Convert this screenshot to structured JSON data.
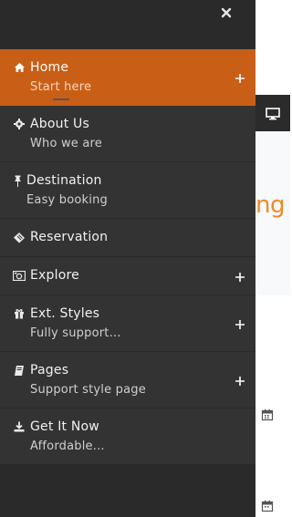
{
  "menu": {
    "items": [
      {
        "label": "Home",
        "sub": "Start here",
        "icon": "home-icon",
        "expandable": true,
        "active": true
      },
      {
        "label": "About Us",
        "sub": "Who we are",
        "icon": "gear-icon",
        "expandable": false,
        "active": false
      },
      {
        "label": "Destination",
        "sub": "Easy booking",
        "icon": "pin-icon",
        "expandable": false,
        "active": false
      },
      {
        "label": "Reservation",
        "sub": "",
        "icon": "ticket-icon",
        "expandable": false,
        "active": false
      },
      {
        "label": "Explore",
        "sub": "",
        "icon": "camera-icon",
        "expandable": true,
        "active": false
      },
      {
        "label": "Ext. Styles",
        "sub": "Fully support...",
        "icon": "gift-icon",
        "expandable": true,
        "active": false
      },
      {
        "label": "Pages",
        "sub": "Support style page",
        "icon": "book-icon",
        "expandable": true,
        "active": false
      },
      {
        "label": "Get It Now",
        "sub": "Affordable...",
        "icon": "download-icon",
        "expandable": false,
        "active": false
      }
    ]
  },
  "background": {
    "heading_fragment": "ng"
  },
  "colors": {
    "accent": "#c95f17",
    "menu_bg": "#333333",
    "heading_orange": "#f08a24"
  }
}
